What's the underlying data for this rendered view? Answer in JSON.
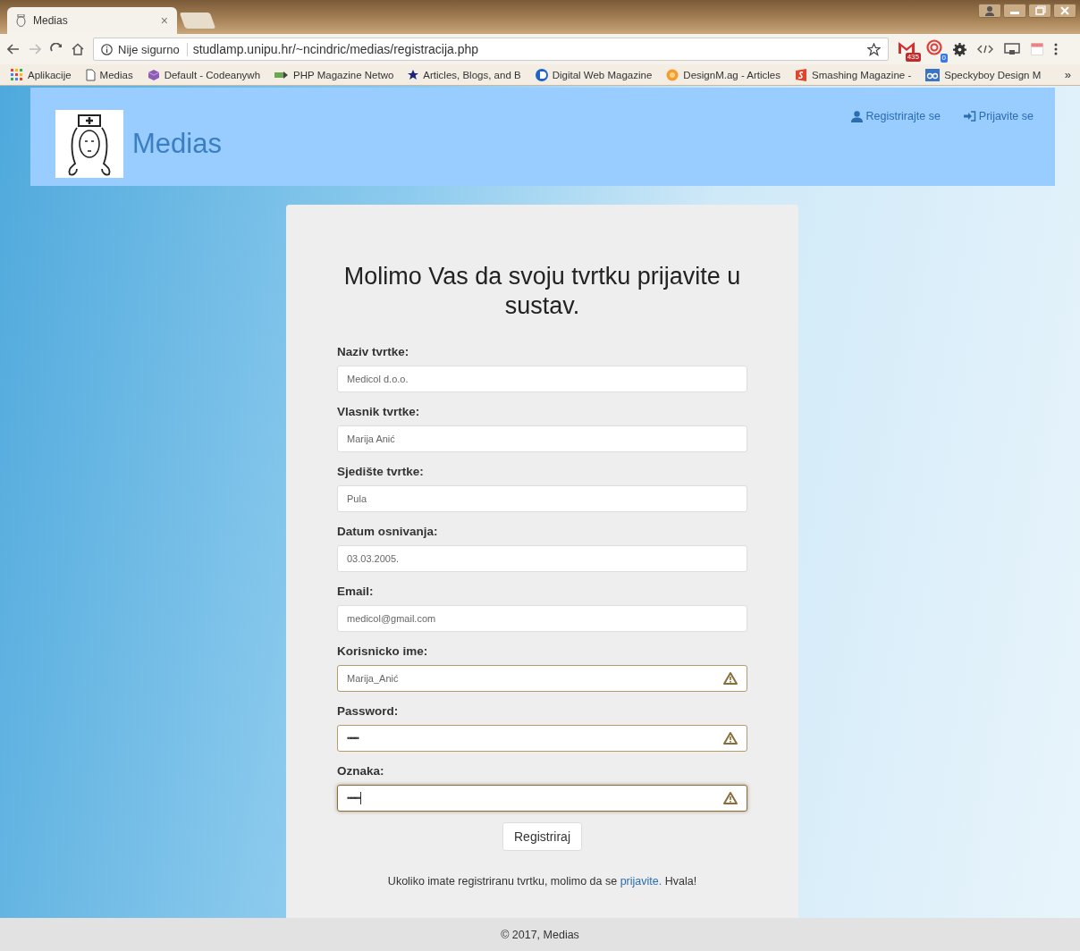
{
  "browser": {
    "tab": {
      "title": "Medias",
      "close": "×"
    },
    "address_bar": {
      "security": "Nije sigurno",
      "url": "studlamp.unipu.hr/~ncindric/medias/registracija.php"
    },
    "mail_badge": "435",
    "notify_badge": "0",
    "bookmarks": [
      {
        "label": "Aplikacije",
        "kind": "apps"
      },
      {
        "label": "Medias",
        "kind": "page"
      },
      {
        "label": "Default - Codeanywh",
        "kind": "cube"
      },
      {
        "label": "PHP Magazine Netwo",
        "kind": "arrow"
      },
      {
        "label": "Articles, Blogs, and B",
        "kind": "star"
      },
      {
        "label": "Digital Web Magazine",
        "kind": "disc"
      },
      {
        "label": "DesignM.ag - Articles",
        "kind": "sun"
      },
      {
        "label": "Smashing Magazine -",
        "kind": "flag"
      },
      {
        "label": "Speckyboy Design M",
        "kind": "square"
      }
    ],
    "bookmarks_more": "»"
  },
  "header": {
    "brand": "Medias",
    "nav": [
      {
        "label": "Registrirajte se",
        "kind": "register"
      },
      {
        "label": "Prijavite se",
        "kind": "login"
      }
    ]
  },
  "form": {
    "title": "Molimo Vas da svoju tvrtku prijavite u sustav.",
    "fields": [
      {
        "label": "Naziv tvrtke:",
        "value": "Medicol d.o.o.",
        "kind": "text",
        "warning": false,
        "focused": false
      },
      {
        "label": "Vlasnik tvrtke:",
        "value": "Marija Anić",
        "kind": "text",
        "warning": false,
        "focused": false
      },
      {
        "label": "Sjedište tvrtke:",
        "value": "Pula",
        "kind": "text",
        "warning": false,
        "focused": false
      },
      {
        "label": "Datum osnivanja:",
        "value": "03.03.2005.",
        "kind": "text",
        "warning": false,
        "focused": false
      },
      {
        "label": "Email:",
        "value": "medicol@gmail.com",
        "kind": "text",
        "warning": false,
        "focused": false
      },
      {
        "label": "Korisnicko ime:",
        "value": "Marija_Anić",
        "kind": "text",
        "warning": true,
        "focused": false
      },
      {
        "label": "Password:",
        "value": "••••••",
        "kind": "password",
        "warning": true,
        "focused": false
      },
      {
        "label": "Oznaka:",
        "value": "•••••••",
        "kind": "password",
        "warning": true,
        "focused": true
      }
    ],
    "submit": "Registriraj",
    "note": {
      "before": "Ukoliko imate registriranu tvrtku, molimo da se ",
      "link": "prijavite.",
      "after": " Hvala!"
    }
  },
  "footer": "© 2017, Medias"
}
